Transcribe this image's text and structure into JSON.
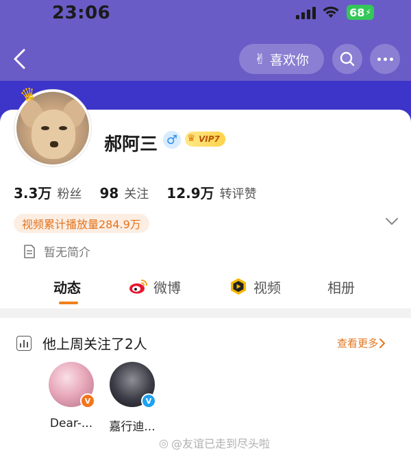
{
  "status_bar": {
    "time": "23:06",
    "battery": "68",
    "colors": {
      "battery": "#34c759"
    }
  },
  "header": {
    "like_label": "喜欢你",
    "colors": {
      "hero": "#6a5cc6",
      "hero_deep": "#3d34c9"
    }
  },
  "profile": {
    "name": "郝阿三",
    "gender_symbol": "♂",
    "vip_label": "VIP7",
    "stats": [
      {
        "value": "3.3万",
        "label": "粉丝"
      },
      {
        "value": "98",
        "label": "关注"
      },
      {
        "value": "12.9万",
        "label": "转评赞"
      }
    ],
    "video_plays": "视频累计播放量284.9万",
    "intro": "暂无简介"
  },
  "tabs": [
    {
      "label": "动态",
      "icon": "none",
      "active": true
    },
    {
      "label": "微博",
      "icon": "weibo-icon",
      "active": false
    },
    {
      "label": "视频",
      "icon": "video-icon",
      "active": false
    },
    {
      "label": "相册",
      "icon": "none",
      "active": false
    }
  ],
  "follow_card": {
    "title": "他上周关注了2人",
    "see_more": "查看更多",
    "users": [
      {
        "name": "Dear-...",
        "badge": "V",
        "badge_color": "#f2751b"
      },
      {
        "name": "嘉行迪...",
        "badge": "V",
        "badge_color": "#1da1f2"
      }
    ]
  },
  "watermark": "@友谊已走到尽头啦",
  "colors": {
    "accent": "#f08019",
    "link": "#e2741e"
  }
}
